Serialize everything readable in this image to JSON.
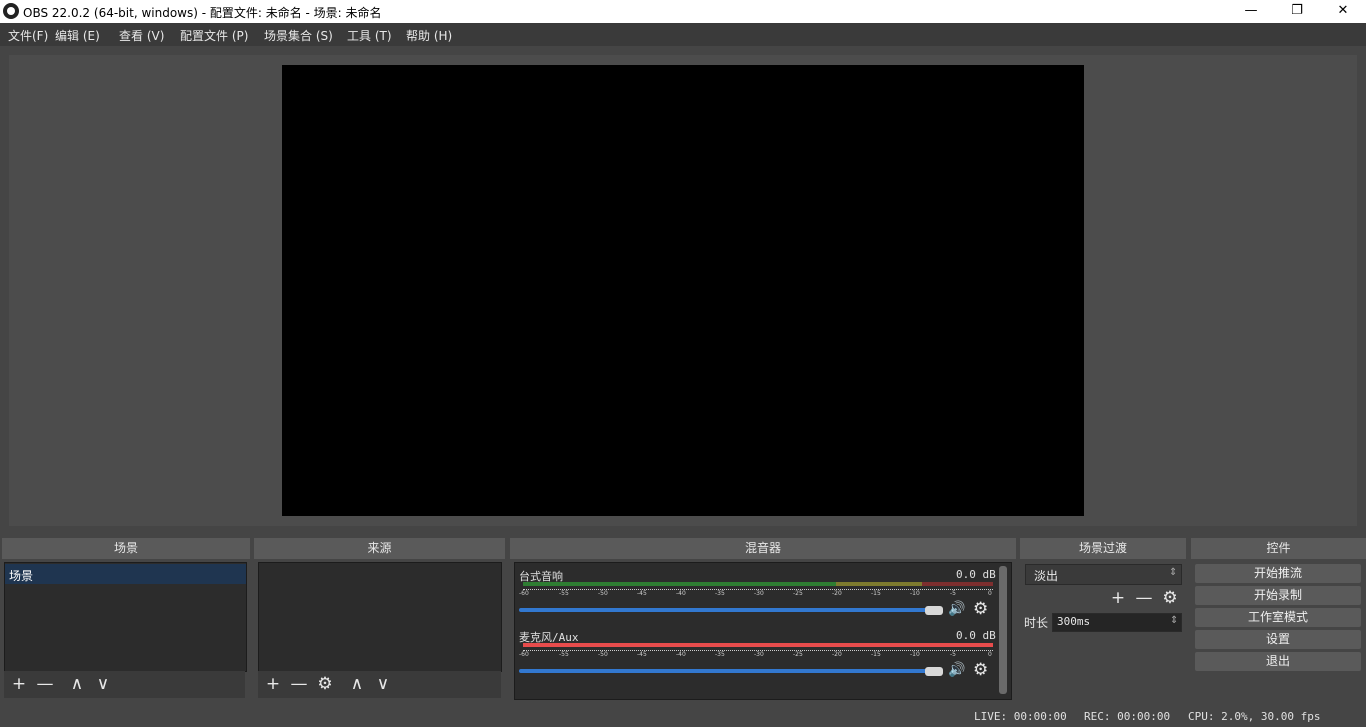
{
  "window": {
    "title": "OBS 22.0.2 (64-bit, windows) - 配置文件: 未命名 - 场景: 未命名",
    "minimize": "—",
    "maximize": "❐",
    "close": "✕"
  },
  "menu": [
    "文件(F)",
    "编辑 (E)",
    "查看 (V)",
    "配置文件 (P)",
    "场景集合 (S)",
    "工具 (T)",
    "帮助 (H)"
  ],
  "docks": {
    "scenes": {
      "title": "场景",
      "items": [
        "场景"
      ]
    },
    "sources": {
      "title": "来源"
    },
    "mixer": {
      "title": "混音器",
      "tracks": [
        {
          "name": "台式音响",
          "db": "0.0 dB"
        },
        {
          "name": "麦克风/Aux",
          "db": "0.0 dB"
        }
      ],
      "ticks": [
        "-60",
        "-55",
        "-50",
        "-45",
        "-40",
        "-35",
        "-30",
        "-25",
        "-20",
        "-15",
        "-10",
        "-5",
        "0"
      ]
    },
    "transitions": {
      "title": "场景过渡",
      "selected": "淡出",
      "duration_label": "时长",
      "duration_value": "300ms"
    },
    "controls": {
      "title": "控件",
      "buttons": [
        "开始推流",
        "开始录制",
        "工作室模式",
        "设置",
        "退出"
      ]
    }
  },
  "status": {
    "live": "LIVE: 00:00:00",
    "rec": "REC: 00:00:00",
    "cpu": "CPU: 2.0%, 30.00 fps"
  },
  "icons": {
    "add": "+",
    "remove": "—",
    "up": "∧",
    "down": "∨",
    "gear": "⚙",
    "speaker": "🔊"
  },
  "colors": {
    "meter_green": "#2e7d32",
    "meter_yellow": "#7d7a2e",
    "meter_red": "#7d2e2e",
    "mic_meter": "#e84c4c",
    "slider": "#3278d0"
  }
}
